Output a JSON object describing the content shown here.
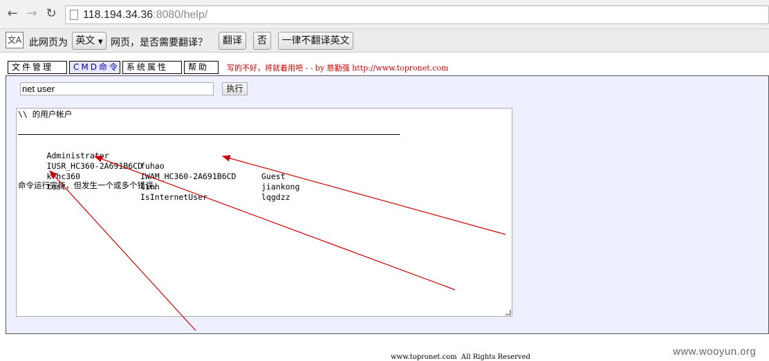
{
  "browser": {
    "url_host": "118.194.34.36",
    "url_rest": ":8080/help/"
  },
  "translate_bar": {
    "icon_text": "文A",
    "prefix": "此网页为",
    "language": "英文",
    "question": "网页，是否需要翻译？",
    "translate_label": "翻译",
    "no_label": "否",
    "never_label": "一律不翻译英文"
  },
  "menu": {
    "items": [
      "文件管理",
      "CMD命令",
      "系统属性",
      "帮助"
    ],
    "credit": "写的不好，将就着用吧 - - by 慈勤强 http://www.topronet.com"
  },
  "command": {
    "input_value": "net user",
    "run_label": "执行"
  },
  "output": {
    "header": "\\\\ 的用户帐户",
    "rows": [
      [
        "Administrator",
        "fuhao",
        "Guest"
      ],
      [
        "IUSR_HC360-2A691B6CD",
        "IWAM_HC360-2A691B6CD",
        "jiankong"
      ],
      [
        "kfhc360",
        "linh",
        "lqgdzz"
      ],
      [
        "test",
        "IsInternetUser",
        ""
      ]
    ],
    "footer": "命令运行完毕，但发生一个或多个错误。"
  },
  "footer_text": "www.topronet.com  All Rights Reserved",
  "watermark": "www.wooyun.org",
  "colors": {
    "annotation": "#cc0000",
    "panel_bg": "#eef0ff"
  }
}
